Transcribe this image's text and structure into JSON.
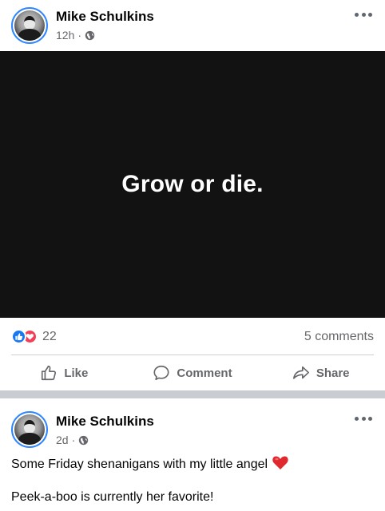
{
  "posts": [
    {
      "author": "Mike Schulkins",
      "time": "12h",
      "separator": "·",
      "text_image": "Grow or die.",
      "reaction_count": "22",
      "comments": "5 comments",
      "actions": {
        "like": "Like",
        "comment": "Comment",
        "share": "Share"
      }
    },
    {
      "author": "Mike Schulkins",
      "time": "2d",
      "separator": "·",
      "caption_line1": "Some Friday shenanigans with my little angel",
      "caption_line2": "Peek-a-boo is currently her favorite!"
    }
  ],
  "icons": [
    "more-icon",
    "globe-icon",
    "like-reaction-icon",
    "love-reaction-icon",
    "like-icon",
    "comment-icon",
    "share-icon",
    "heart-emoji-icon"
  ],
  "colors": {
    "like": "#1877f2",
    "love": "#f33e58",
    "avatar_ring": "#2d86ff",
    "image_bg": "#121212",
    "meta": "#65676b"
  }
}
